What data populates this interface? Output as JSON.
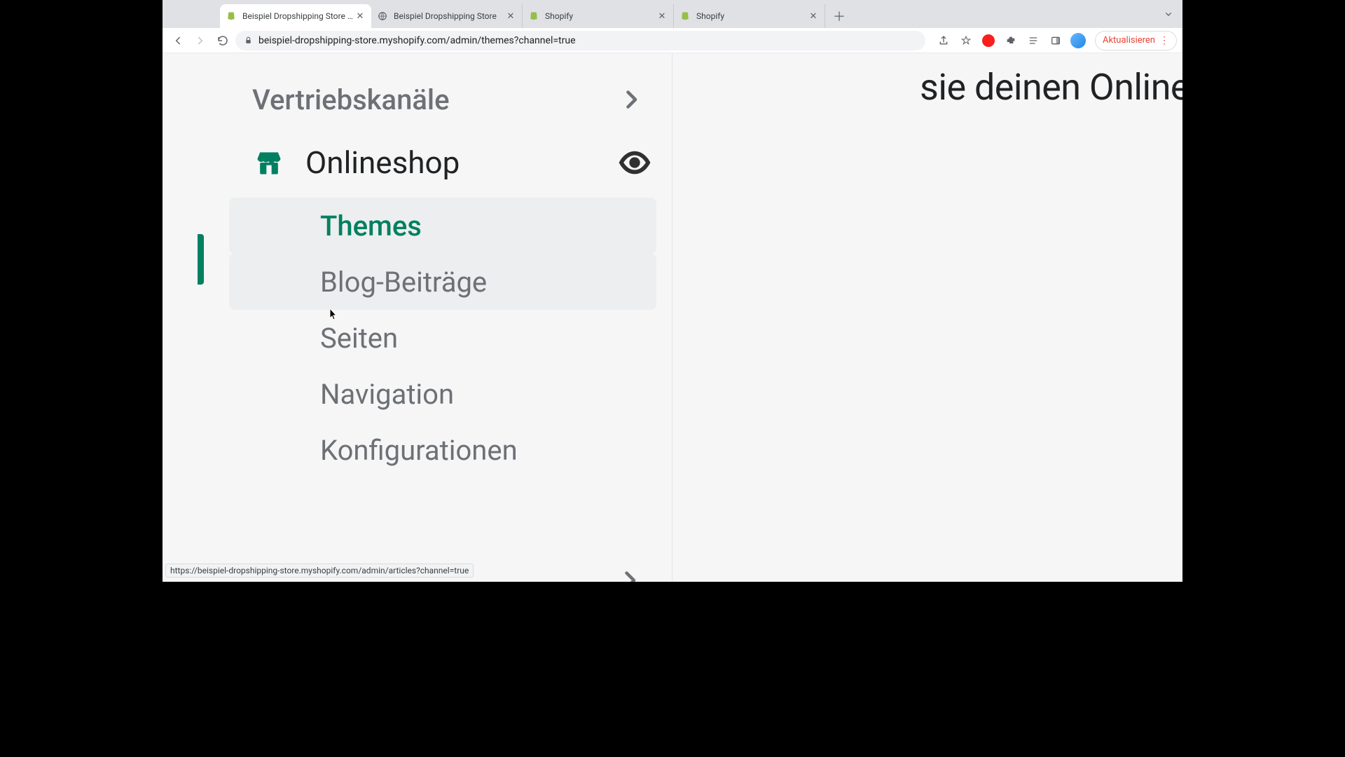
{
  "browser": {
    "tabs": [
      {
        "title": "Beispiel Dropshipping Store · T",
        "favicon": "shopify"
      },
      {
        "title": "Beispiel Dropshipping Store",
        "favicon": "globe"
      },
      {
        "title": "Shopify",
        "favicon": "shopify"
      },
      {
        "title": "Shopify",
        "favicon": "shopify"
      }
    ],
    "url": "beispiel-dropshipping-store.myshopify.com/admin/themes?channel=true",
    "update_label": "Aktualisieren"
  },
  "sidebar": {
    "section_label": "Vertriebskanäle",
    "channel_label": "Onlineshop",
    "items": [
      {
        "label": "Themes"
      },
      {
        "label": "Blog-Beiträge"
      },
      {
        "label": "Seiten"
      },
      {
        "label": "Navigation"
      },
      {
        "label": "Konfigurationen"
      }
    ]
  },
  "main": {
    "heading_fragment": "sie deinen Online"
  },
  "status_url": "https://beispiel-dropshipping-store.myshopify.com/admin/articles?channel=true"
}
